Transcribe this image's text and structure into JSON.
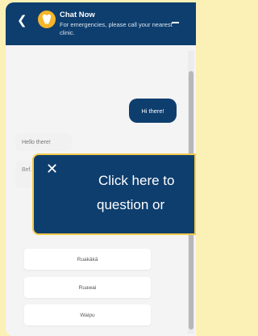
{
  "header": {
    "title": "Chat Now",
    "subtitle": "For emergencies, please call your nearest clinic.",
    "back_icon": "chevron-left-icon",
    "minimize_icon": "minimize-icon",
    "avatar_icon": "tooth-icon"
  },
  "messages": {
    "user": "Hi there!",
    "bot": "Hello there!",
    "bot2_partial": "Bef… clin…"
  },
  "options": [
    "Ruakākā",
    "Ruawai",
    "Waipu"
  ],
  "overlay": {
    "close_icon": "close-icon",
    "line1": "Click here to",
    "line2": "question or"
  },
  "colors": {
    "brand": "#0e3e6e",
    "accent": "#f5c94a",
    "page_bg": "#fbf0b6"
  }
}
